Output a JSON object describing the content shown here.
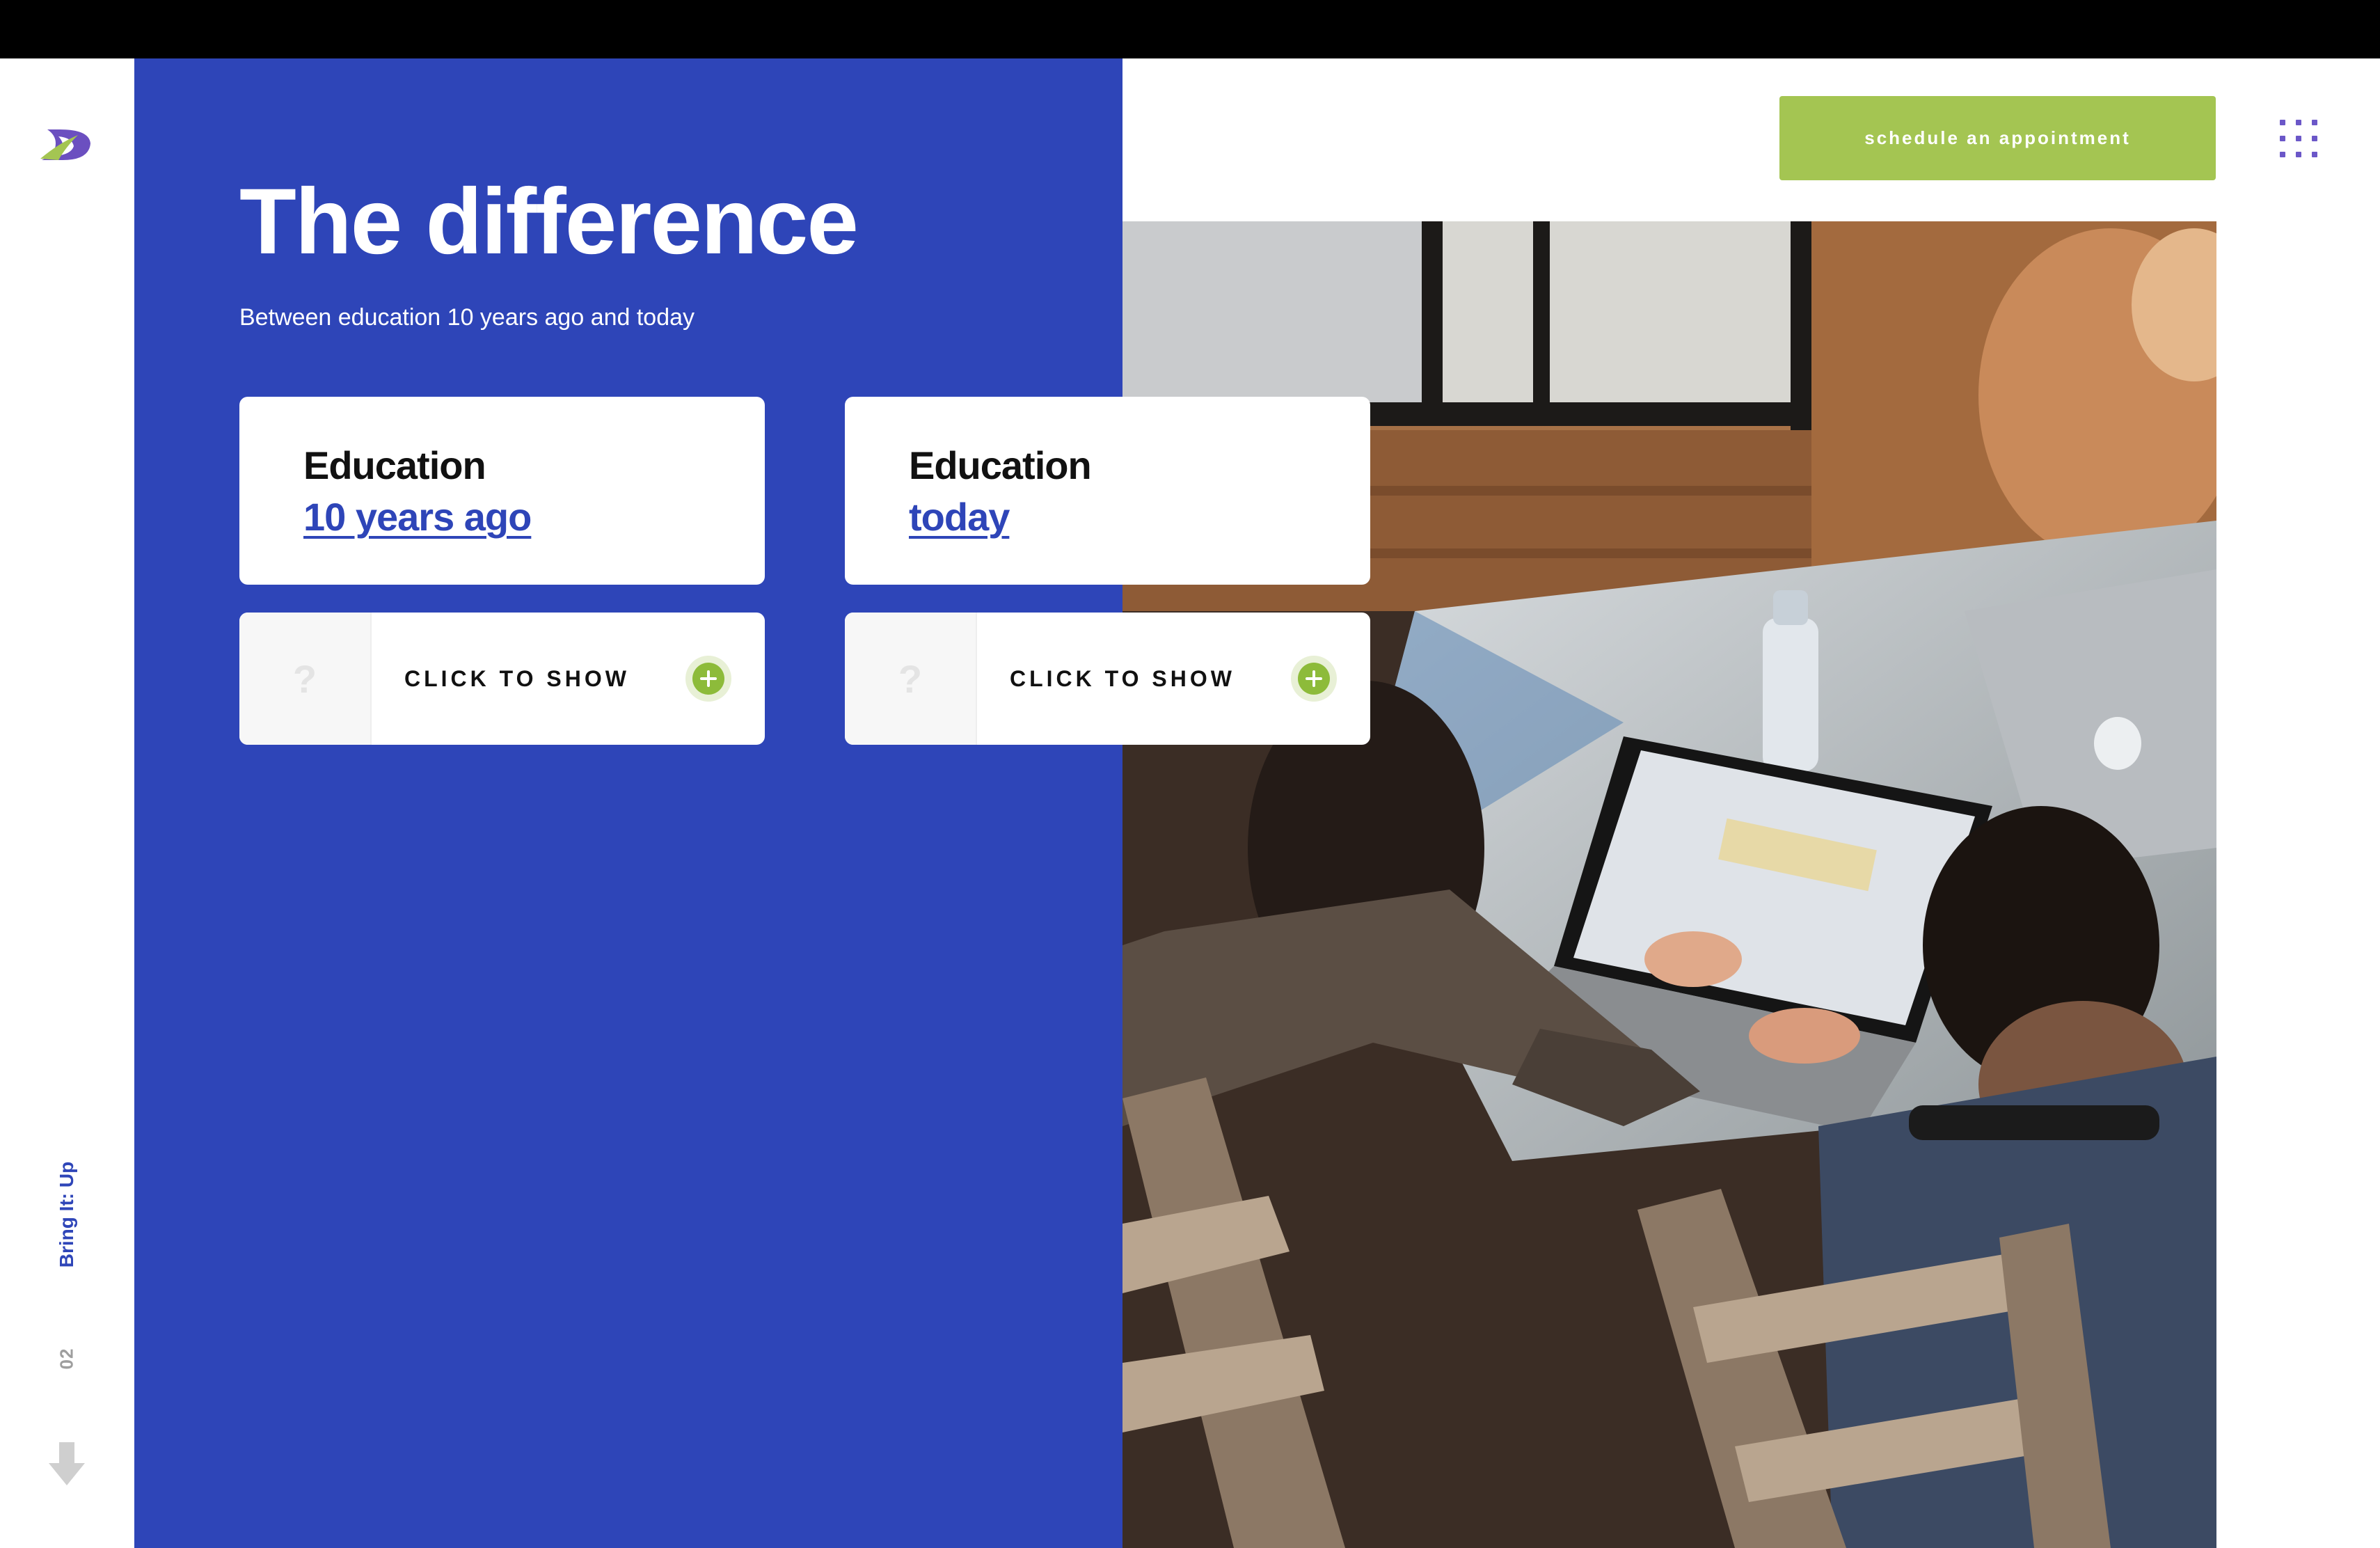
{
  "header": {
    "cta_label": "schedule an appointment",
    "menu_icon": "grid-menu-icon",
    "logo_icon": "brand-logo-icon"
  },
  "sidebar": {
    "brand_label": "Bring It: Up",
    "section_number": "02",
    "scroll_icon": "arrow-down-icon"
  },
  "hero": {
    "title": "The difference",
    "subtitle": "Between education 10 years ago and today"
  },
  "cards": [
    {
      "title": "Education",
      "link": "10 years ago"
    },
    {
      "title": "Education",
      "link": "today"
    }
  ],
  "reveals": [
    {
      "thumb": "?",
      "label": "CLICK TO SHOW",
      "icon": "plus-circle-icon"
    },
    {
      "thumb": "?",
      "label": "CLICK TO SHOW",
      "icon": "plus-circle-icon"
    }
  ],
  "colors": {
    "brand_blue": "#2e45b8",
    "accent_green": "#a4c552",
    "menu_purple": "#6b57c8"
  }
}
